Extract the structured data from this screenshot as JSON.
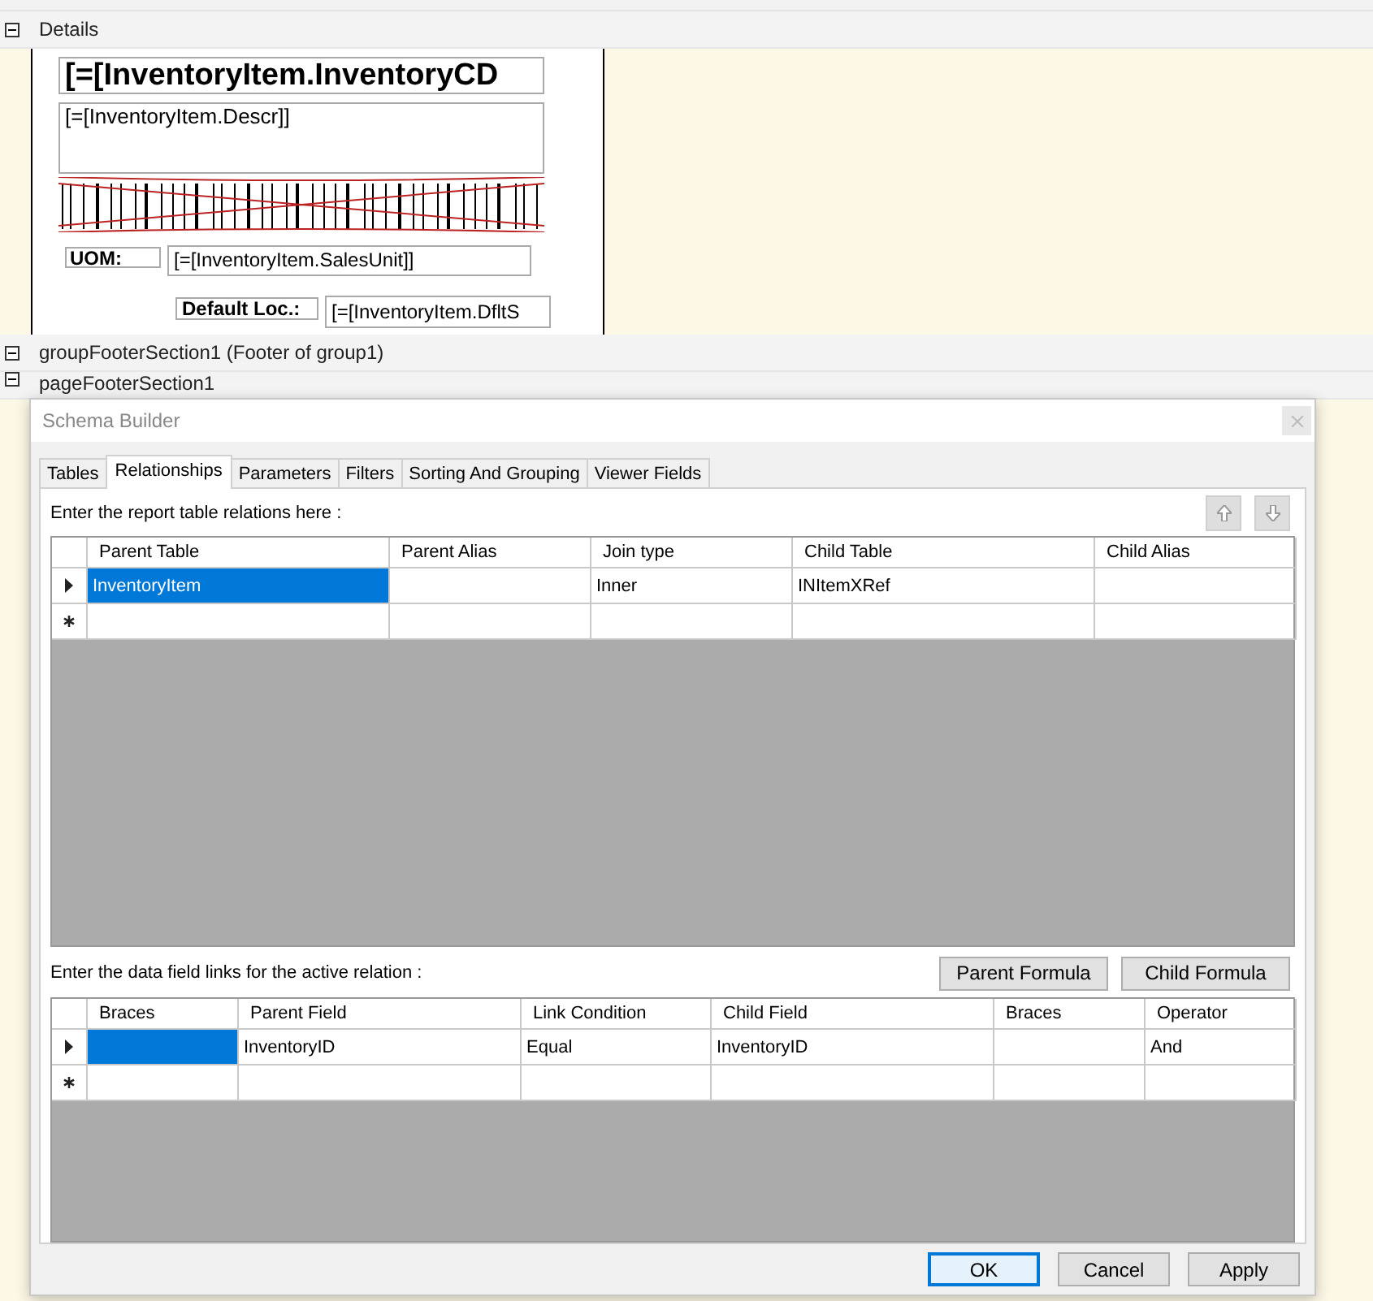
{
  "report": {
    "sections": [
      {
        "title": "Details",
        "expanded": true
      },
      {
        "title": "groupFooterSection1 (Footer of group1)",
        "expanded": true
      },
      {
        "title": "pageFooterSection1",
        "expanded": true
      }
    ],
    "controls": {
      "inventory_cd": "[=[InventoryItem.InventoryCD",
      "descr": "[=[InventoryItem.Descr]]",
      "uom_label": "UOM:",
      "sales_unit": "[=[InventoryItem.SalesUnit]]",
      "default_loc_label": "Default Loc.:",
      "default_loc": "[=[InventoryItem.DfltS"
    }
  },
  "dialog": {
    "title": "Schema Builder",
    "tabs": [
      {
        "label": "Tables",
        "selected": false
      },
      {
        "label": "Relationships",
        "selected": true
      },
      {
        "label": "Parameters",
        "selected": false
      },
      {
        "label": "Filters",
        "selected": false
      },
      {
        "label": "Sorting And Grouping",
        "selected": false
      },
      {
        "label": "Viewer Fields",
        "selected": false
      }
    ],
    "relations_label": "Enter the report table relations here :",
    "move_buttons": [
      {
        "kind": "up",
        "disabled": true
      },
      {
        "kind": "down",
        "disabled": true
      }
    ],
    "relations_grid": {
      "columns": [
        "Parent Table",
        "Parent Alias",
        "Join type",
        "Child Table",
        "Child Alias"
      ],
      "rows": [
        {
          "kind": "current",
          "cells": [
            {
              "value": "InventoryItem",
              "selected": true
            },
            {
              "selected": false
            },
            {
              "value": "Inner",
              "selected": false
            },
            {
              "value": "INItemXRef",
              "selected": false
            },
            {
              "selected": false
            }
          ]
        },
        {
          "kind": "new",
          "cells": [
            {
              "selected": false
            },
            {
              "selected": false
            },
            {
              "selected": false
            },
            {
              "selected": false
            },
            {
              "selected": false
            }
          ]
        }
      ]
    },
    "links_label": "Enter the data field links for the active relation :",
    "formula_buttons": [
      "Parent Formula",
      "Child Formula"
    ],
    "links_grid": {
      "columns": [
        "Braces",
        "Parent Field",
        "Link Condition",
        "Child Field",
        "Braces",
        "Operator"
      ],
      "rows": [
        {
          "kind": "current",
          "cells": [
            {
              "selected": true
            },
            {
              "value": "InventoryID",
              "selected": false
            },
            {
              "value": "Equal",
              "selected": false
            },
            {
              "value": "InventoryID",
              "selected": false
            },
            {
              "selected": false
            },
            {
              "value": "And",
              "selected": false
            }
          ]
        },
        {
          "kind": "new",
          "cells": [
            {
              "selected": false
            },
            {
              "selected": false
            },
            {
              "selected": false
            },
            {
              "selected": false
            },
            {
              "selected": false
            },
            {
              "selected": false
            }
          ]
        }
      ]
    },
    "buttons": [
      {
        "label": "OK",
        "default": true
      },
      {
        "label": "Cancel",
        "default": false
      },
      {
        "label": "Apply",
        "default": false
      }
    ]
  }
}
